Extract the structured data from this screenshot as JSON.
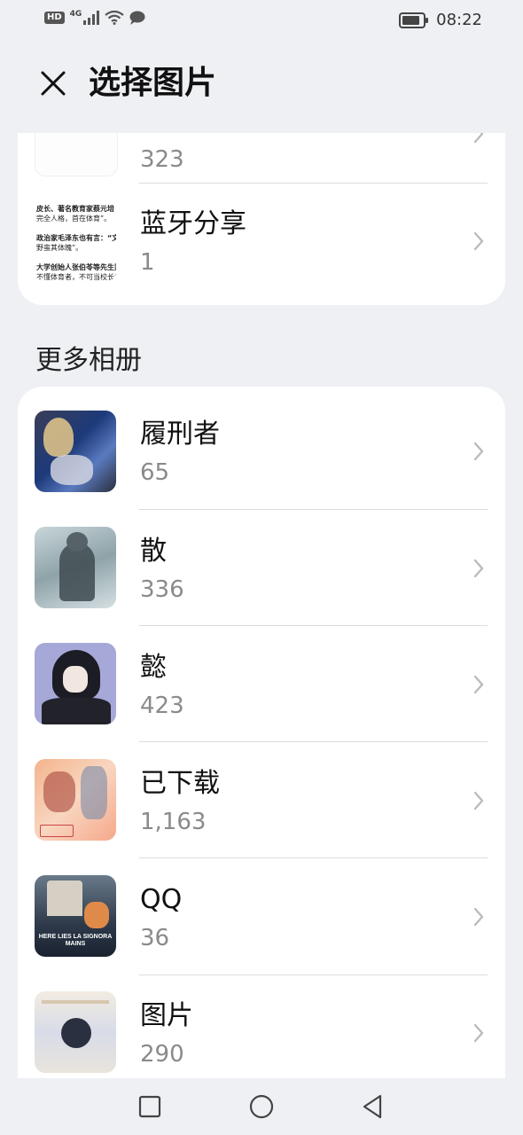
{
  "status_bar": {
    "hd_label": "HD",
    "network_label": "4G",
    "time": "08:22",
    "icons": [
      "signal-icon",
      "wifi-icon",
      "message-icon",
      "battery-icon"
    ]
  },
  "header": {
    "title": "选择图片",
    "close_icon": "close-icon"
  },
  "top_albums": [
    {
      "name": "",
      "count": "323"
    },
    {
      "name": "蓝牙分享",
      "count": "1",
      "thumb_lines": [
        "皮长、著名教育家蔡元培",
        "完全人格，首在体育”。",
        "",
        "政治家毛泽东也有言：“文明",
        "野蛮其体魄”。",
        "",
        "大学创始人张伯苓等先生则",
        "不懂体育者，不可当校长”。"
      ]
    }
  ],
  "more_section_title": "更多相册",
  "albums": [
    {
      "name": "履刑者",
      "count": "65"
    },
    {
      "name": "散",
      "count": "336"
    },
    {
      "name": "懿",
      "count": "423"
    },
    {
      "name": "已下载",
      "count": "1,163"
    },
    {
      "name": "QQ",
      "count": "36",
      "thumb_text": "HERE LIES LA SIGNORA MAINS"
    },
    {
      "name": "图片",
      "count": "290"
    }
  ],
  "nav": {
    "recents_icon": "square-icon",
    "home_icon": "circle-icon",
    "back_icon": "triangle-back-icon"
  },
  "colors": {
    "background": "#eef0f4",
    "card": "#ffffff",
    "secondary_text": "#8a8a8a"
  }
}
